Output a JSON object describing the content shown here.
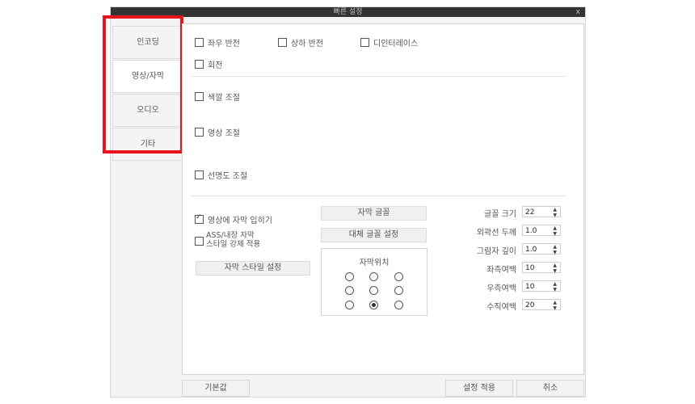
{
  "window": {
    "title": "빠른 설정",
    "close_label": "x"
  },
  "sidebar": {
    "items": [
      {
        "label": "인코딩"
      },
      {
        "label": "영상/자막"
      },
      {
        "label": "오디오"
      },
      {
        "label": "기타"
      }
    ]
  },
  "video": {
    "flip_horizontal": "좌우 반전",
    "flip_vertical": "상하 반전",
    "deinterlace": "디인터레이스",
    "rotate": "회전",
    "color_adjust": "색깔 조절",
    "image_adjust": "영상 조절",
    "sharpness_adjust": "선명도 조절"
  },
  "subtitle": {
    "burn_in": "영상에 자막 입히기",
    "ass_force_line1": "ASS/내장 자막",
    "ass_force_line2": "스타일 강제 적용",
    "style_settings_button": "자막 스타일 설정",
    "font_button": "자막 글꼴",
    "alt_font_button": "대체 글꼴 설정",
    "position_title": "자막위치",
    "position_selected": "bottom-center",
    "font_size_label": "글꼴 크기",
    "font_size_value": "22",
    "outline_label": "외곽선 두께",
    "outline_value": "1.0",
    "shadow_label": "그림자 깊이",
    "shadow_value": "1.0",
    "margin_left_label": "좌측여백",
    "margin_left_value": "10",
    "margin_right_label": "우측여백",
    "margin_right_value": "10",
    "margin_vertical_label": "수직여백",
    "margin_vertical_value": "20"
  },
  "footer": {
    "default_button": "기본값",
    "apply_button": "설정 적용",
    "cancel_button": "취소"
  },
  "colors": {
    "highlight": "#e8141c",
    "titlebar": "#333333"
  }
}
